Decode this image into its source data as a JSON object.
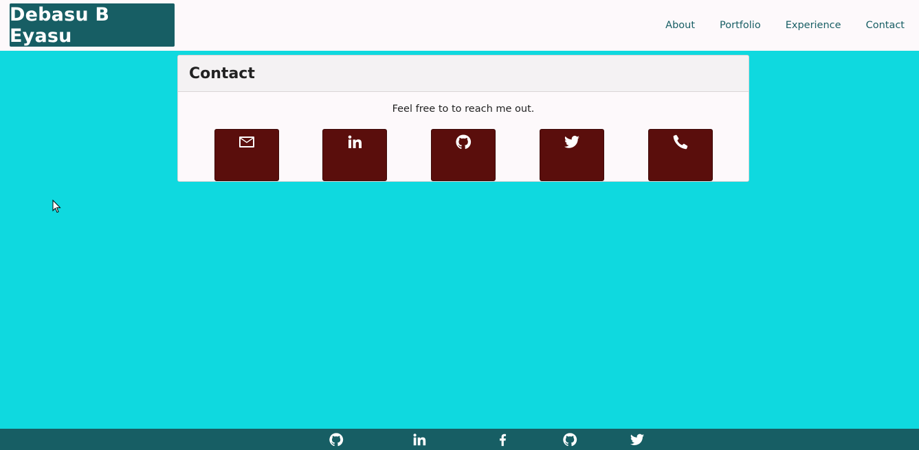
{
  "header": {
    "brand": "Debasu B Eyasu",
    "nav": [
      {
        "label": "About"
      },
      {
        "label": "Portfolio"
      },
      {
        "label": "Experience"
      },
      {
        "label": "Contact"
      }
    ]
  },
  "contact": {
    "title": "Contact",
    "text": "Feel free to to reach me out.",
    "buttons": [
      {
        "icon": "envelope-icon"
      },
      {
        "icon": "linkedin-icon"
      },
      {
        "icon": "github-icon"
      },
      {
        "icon": "twitter-icon"
      },
      {
        "icon": "phone-icon"
      }
    ]
  },
  "footer": {
    "icons": [
      "github-icon",
      "linkedin-icon",
      "facebook-icon",
      "github-icon",
      "twitter-icon"
    ]
  },
  "colors": {
    "background": "#0fd9df",
    "brand": "#175e64",
    "button": "#5a0e0c",
    "navbar": "#fdf9fb"
  }
}
